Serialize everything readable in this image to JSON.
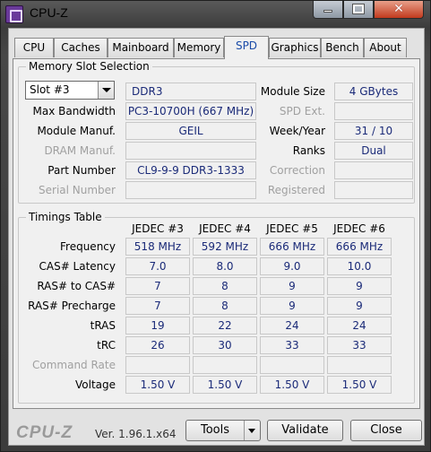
{
  "window": {
    "title": "CPU-Z"
  },
  "tabs": [
    {
      "label": "CPU"
    },
    {
      "label": "Caches"
    },
    {
      "label": "Mainboard"
    },
    {
      "label": "Memory"
    },
    {
      "label": "SPD"
    },
    {
      "label": "Graphics"
    },
    {
      "label": "Bench"
    },
    {
      "label": "About"
    }
  ],
  "active_tab": "SPD",
  "slot_selection": {
    "legend": "Memory Slot Selection",
    "slot_value": "Slot #3",
    "memory_type": "DDR3",
    "module_size_label": "Module Size",
    "module_size": "4 GBytes",
    "max_bandwidth_label": "Max Bandwidth",
    "max_bandwidth": "PC3-10700H (667 MHz)",
    "spd_ext_label": "SPD Ext.",
    "spd_ext": "",
    "module_manuf_label": "Module Manuf.",
    "module_manuf": "GEIL",
    "week_year_label": "Week/Year",
    "week_year": "31 / 10",
    "dram_manuf_label": "DRAM Manuf.",
    "dram_manuf": "",
    "ranks_label": "Ranks",
    "ranks": "Dual",
    "part_number_label": "Part Number",
    "part_number": "CL9-9-9 DDR3-1333",
    "correction_label": "Correction",
    "correction": "",
    "serial_number_label": "Serial Number",
    "serial_number": "",
    "registered_label": "Registered",
    "registered": ""
  },
  "timings": {
    "legend": "Timings Table",
    "columns": [
      "JEDEC #3",
      "JEDEC #4",
      "JEDEC #5",
      "JEDEC #6"
    ],
    "rows": [
      {
        "label": "Frequency",
        "values": [
          "518 MHz",
          "592 MHz",
          "666 MHz",
          "666 MHz"
        ]
      },
      {
        "label": "CAS# Latency",
        "values": [
          "7.0",
          "8.0",
          "9.0",
          "10.0"
        ]
      },
      {
        "label": "RAS# to CAS#",
        "values": [
          "7",
          "8",
          "9",
          "9"
        ]
      },
      {
        "label": "RAS# Precharge",
        "values": [
          "7",
          "8",
          "9",
          "9"
        ]
      },
      {
        "label": "tRAS",
        "values": [
          "19",
          "22",
          "24",
          "24"
        ]
      },
      {
        "label": "tRC",
        "values": [
          "26",
          "30",
          "33",
          "33"
        ]
      },
      {
        "label": "Command Rate",
        "values": [
          "",
          "",
          "",
          ""
        ]
      },
      {
        "label": "Voltage",
        "values": [
          "1.50 V",
          "1.50 V",
          "1.50 V",
          "1.50 V"
        ]
      }
    ]
  },
  "footer": {
    "brand": "CPU-Z",
    "version": "Ver. 1.96.1.x64",
    "tools_label": "Tools",
    "validate_label": "Validate",
    "close_label": "Close"
  }
}
